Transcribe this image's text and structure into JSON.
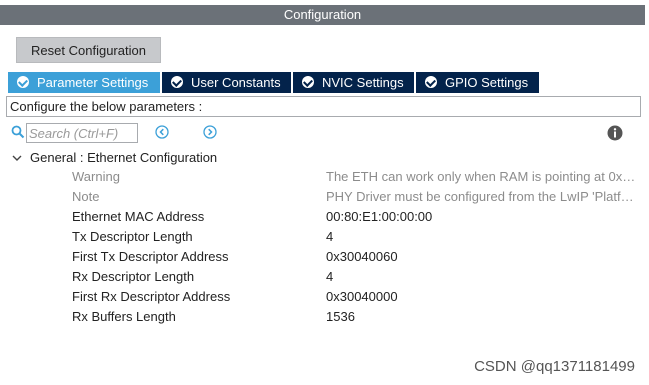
{
  "window": {
    "title": "Configuration"
  },
  "reset_button": {
    "label": "Reset Configuration"
  },
  "tabs": [
    {
      "label": "Parameter Settings",
      "active": true
    },
    {
      "label": "User Constants",
      "active": false
    },
    {
      "label": "NVIC Settings",
      "active": false
    },
    {
      "label": "GPIO Settings",
      "active": false
    }
  ],
  "description": "Configure the below parameters :",
  "search": {
    "placeholder": "Search (Ctrl+F)"
  },
  "group": {
    "label": "General : Ethernet Configuration",
    "rows": [
      {
        "name": "Warning",
        "value": "The ETH can work only when RAM is pointing at 0x…",
        "muted": true
      },
      {
        "name": "Note",
        "value": "PHY Driver must be configured from the LwIP 'Platfo…",
        "muted": true
      },
      {
        "name": "Ethernet MAC Address",
        "value": "00:80:E1:00:00:00"
      },
      {
        "name": "Tx Descriptor Length",
        "value": "4"
      },
      {
        "name": "First Tx Descriptor Address",
        "value": "0x30040060"
      },
      {
        "name": "Rx Descriptor Length",
        "value": "4"
      },
      {
        "name": "First Rx Descriptor Address",
        "value": "0x30040000"
      },
      {
        "name": "Rx Buffers Length",
        "value": "1536"
      }
    ]
  },
  "watermark": "CSDN @qq1371181499",
  "colors": {
    "titlebar": "#6b7178",
    "tab_active": "#3ca0d8",
    "tab_inactive": "#03234b",
    "icon_blue": "#3ca0d8"
  }
}
